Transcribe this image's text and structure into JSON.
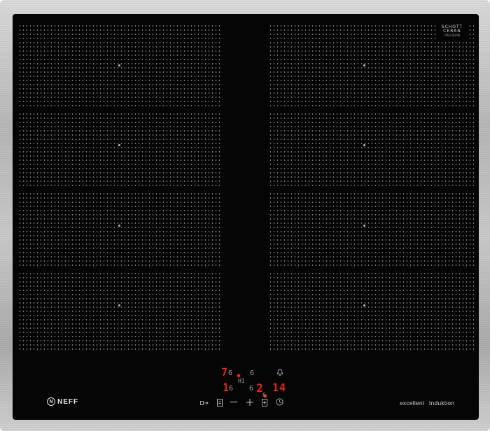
{
  "panel": {
    "glass_color": "#050505",
    "frame_color": "#bdbdbd",
    "display_color": "#ff2a1a"
  },
  "glass_brand": {
    "line1": "SCHOTT",
    "line2": "CERAN",
    "line3": "PRECISION"
  },
  "brand": {
    "badge": "N",
    "name": "NEFF"
  },
  "tagline": {
    "word1": "excellent",
    "word2": "Induktion"
  },
  "display": {
    "front_left_level": "7",
    "rear_left_level": "1",
    "center_top_level": "6",
    "center_mid_level": "6",
    "center_left_small": "6",
    "boost_label": "HI",
    "right_level": "2",
    "timer": "14",
    "bottom_small": "6"
  },
  "controls": [
    {
      "name": "flexzone-icon"
    },
    {
      "name": "minus-icon"
    },
    {
      "name": "plus-icon"
    },
    {
      "name": "timer-icon"
    },
    {
      "name": "clock-icon"
    },
    {
      "name": "bell-icon"
    }
  ]
}
